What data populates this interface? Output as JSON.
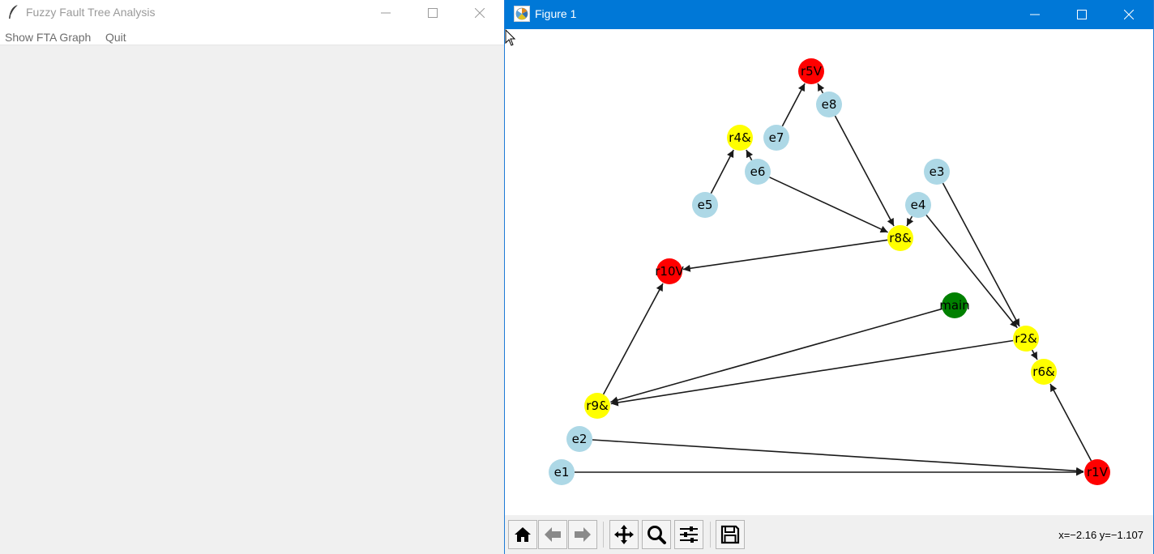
{
  "tk_window": {
    "title": "Fuzzy Fault Tree Analysis",
    "menu": [
      "Show FTA Graph",
      "Quit"
    ],
    "icon": "feather-icon"
  },
  "figure_window": {
    "title": "Figure 1",
    "icon": "matplotlib-icon",
    "toolbar": {
      "buttons": [
        "home-icon",
        "back-arrow-icon",
        "forward-arrow-icon",
        "pan-icon",
        "zoom-icon",
        "configure-subplots-icon",
        "save-icon"
      ],
      "coords_readout": "x=−2.16 y=−1.107"
    }
  },
  "graph": {
    "colors": {
      "event": "#add8e6",
      "and_gate": "#ffff00",
      "or_gate": "#ff0000",
      "top": "#008000",
      "edge": "#1a1a1a"
    },
    "nodes": [
      {
        "id": "r5V",
        "label": "r5V",
        "kind": "or"
      },
      {
        "id": "e8",
        "label": "e8",
        "kind": "event"
      },
      {
        "id": "r4&",
        "label": "r4&",
        "kind": "and"
      },
      {
        "id": "e7",
        "label": "e7",
        "kind": "event"
      },
      {
        "id": "e6",
        "label": "e6",
        "kind": "event"
      },
      {
        "id": "e3",
        "label": "e3",
        "kind": "event"
      },
      {
        "id": "e5",
        "label": "e5",
        "kind": "event"
      },
      {
        "id": "e4",
        "label": "e4",
        "kind": "event"
      },
      {
        "id": "r8&",
        "label": "r8&",
        "kind": "and"
      },
      {
        "id": "r10V",
        "label": "r10V",
        "kind": "or"
      },
      {
        "id": "main",
        "label": "main",
        "kind": "top"
      },
      {
        "id": "r2&",
        "label": "r2&",
        "kind": "and"
      },
      {
        "id": "r6&",
        "label": "r6&",
        "kind": "and"
      },
      {
        "id": "r9&",
        "label": "r9&",
        "kind": "and"
      },
      {
        "id": "e2",
        "label": "e2",
        "kind": "event"
      },
      {
        "id": "e1",
        "label": "e1",
        "kind": "event"
      },
      {
        "id": "r1V",
        "label": "r1V",
        "kind": "or"
      }
    ],
    "edges": [
      [
        "e8",
        "r5V"
      ],
      [
        "e7",
        "r5V"
      ],
      [
        "e6",
        "r4&"
      ],
      [
        "e5",
        "r4&"
      ],
      [
        "e6",
        "r8&"
      ],
      [
        "e8",
        "r8&"
      ],
      [
        "e4",
        "r8&"
      ],
      [
        "r8&",
        "r10V"
      ],
      [
        "r9&",
        "r10V"
      ],
      [
        "main",
        "r9&"
      ],
      [
        "r2&",
        "r9&"
      ],
      [
        "e3",
        "r2&"
      ],
      [
        "e4",
        "r2&"
      ],
      [
        "r2&",
        "r6&"
      ],
      [
        "r1V",
        "r6&"
      ],
      [
        "e2",
        "r1V"
      ],
      [
        "e1",
        "r1V"
      ]
    ]
  }
}
